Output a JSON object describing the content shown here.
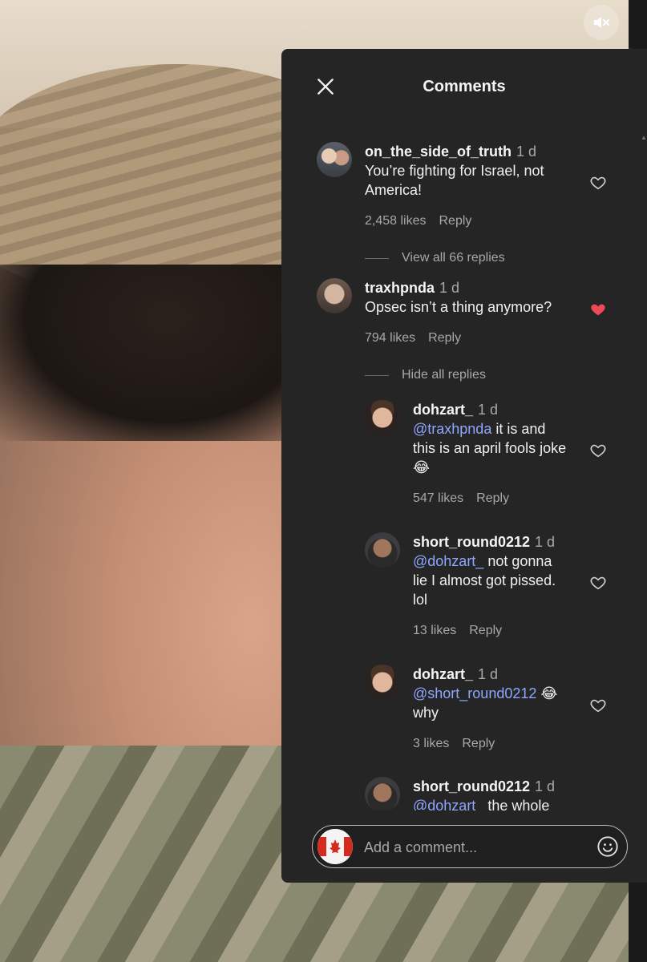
{
  "panel": {
    "title": "Comments",
    "input_placeholder": "Add a comment..."
  },
  "comments": [
    {
      "username": "on_the_side_of_truth",
      "time": "1 d",
      "text_line1": "You’re fighting for Israel, not",
      "text_line2": "America!",
      "likes": "2,458 likes",
      "reply": "Reply",
      "liked": false,
      "thread_toggle": "View all 66 replies"
    },
    {
      "username": "traxhpnda",
      "time": "1 d",
      "text_line1": "Opsec isn’t a thing anymore?",
      "likes": "794 likes",
      "reply": "Reply",
      "liked": true,
      "thread_toggle": "Hide all replies"
    }
  ],
  "replies": [
    {
      "username": "dohzart_",
      "time": "1 d",
      "mention": "@traxhpnda",
      "text_line1_rest": " it is and",
      "text_line2": "this is an april fools joke",
      "text_line3": "😂",
      "likes": "547 likes",
      "reply": "Reply"
    },
    {
      "username": "short_round0212",
      "time": "1 d",
      "mention": "@dohzart_",
      "text_line1_rest": " not gonna",
      "text_line2": "lie I almost got pissed.",
      "text_line3": "lol",
      "likes": "13 likes",
      "reply": "Reply"
    },
    {
      "username": "dohzart_",
      "time": "1 d",
      "mention": "@short_round0212",
      "text_line1_rest": " 😂",
      "text_line2": "why",
      "likes": "3 likes",
      "reply": "Reply"
    },
    {
      "username": "short_round0212",
      "time": "1 d",
      "mention": "@dohzart_",
      "text_line1_rest": " the whole"
    }
  ],
  "colors": {
    "panel_bg": "#252525",
    "mention": "#8fa7ff",
    "liked_heart": "#ed4956"
  },
  "icons": [
    "mute-icon",
    "close-icon",
    "heart-icon",
    "heart-filled-icon",
    "emoji-icon",
    "canada-flag-icon"
  ]
}
